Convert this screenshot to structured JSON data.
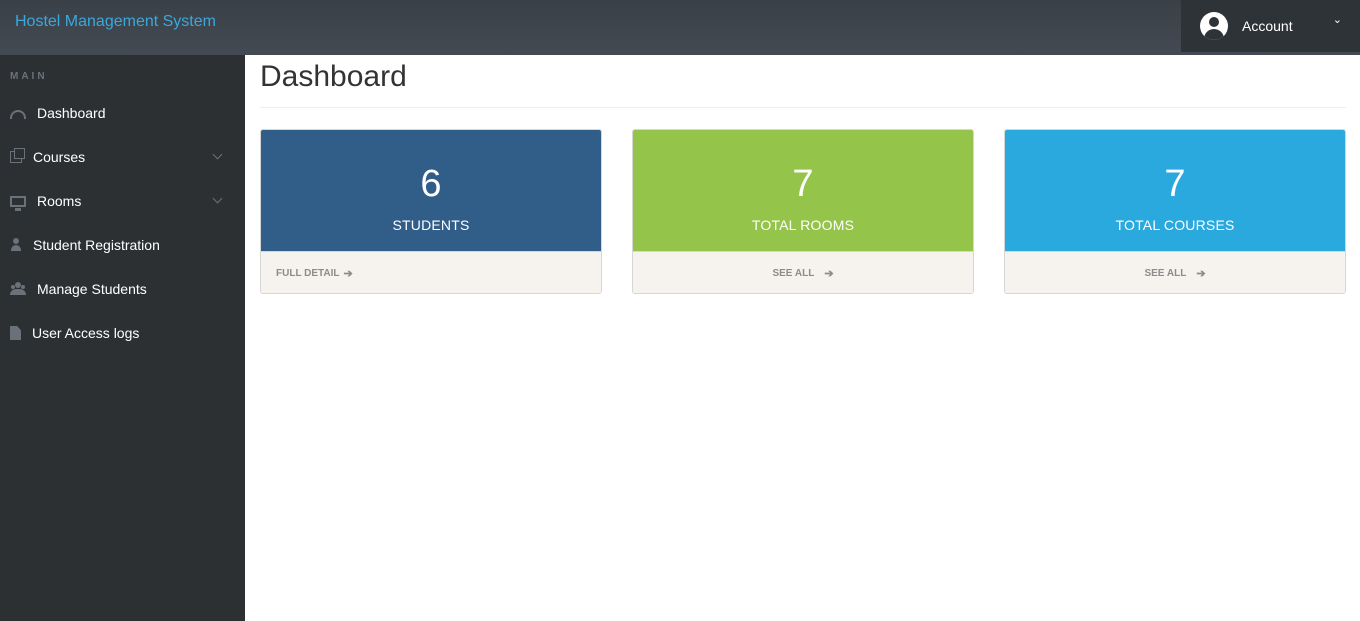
{
  "header": {
    "brand": "Hostel Management System",
    "account_label": "Account",
    "caret": "⌄"
  },
  "sidebar": {
    "section_title": "MAIN",
    "items": [
      {
        "label": "Dashboard",
        "icon": "dashboard-icon",
        "has_submenu": false
      },
      {
        "label": "Courses",
        "icon": "copy-icon",
        "has_submenu": true
      },
      {
        "label": "Rooms",
        "icon": "desktop-icon",
        "has_submenu": true
      },
      {
        "label": "Student Registration",
        "icon": "user-icon",
        "has_submenu": false
      },
      {
        "label": "Manage Students",
        "icon": "users-icon",
        "has_submenu": false
      },
      {
        "label": "User Access logs",
        "icon": "file-icon",
        "has_submenu": false
      }
    ]
  },
  "main": {
    "page_title": "Dashboard",
    "cards": [
      {
        "count": "6",
        "label": "STUDENTS",
        "link": "FULL DETAIL",
        "color": "#315d89"
      },
      {
        "count": "7",
        "label": "TOTAL ROOMS",
        "link": "SEE ALL",
        "color": "#94c44a"
      },
      {
        "count": "7",
        "label": "TOTAL COURSES",
        "link": "SEE ALL",
        "color": "#29a9de"
      }
    ],
    "arrow": "➔"
  },
  "colors": {
    "topbar": "#3a4047",
    "sidebar": "#2c3033",
    "brand_text": "#3aa8dc"
  }
}
